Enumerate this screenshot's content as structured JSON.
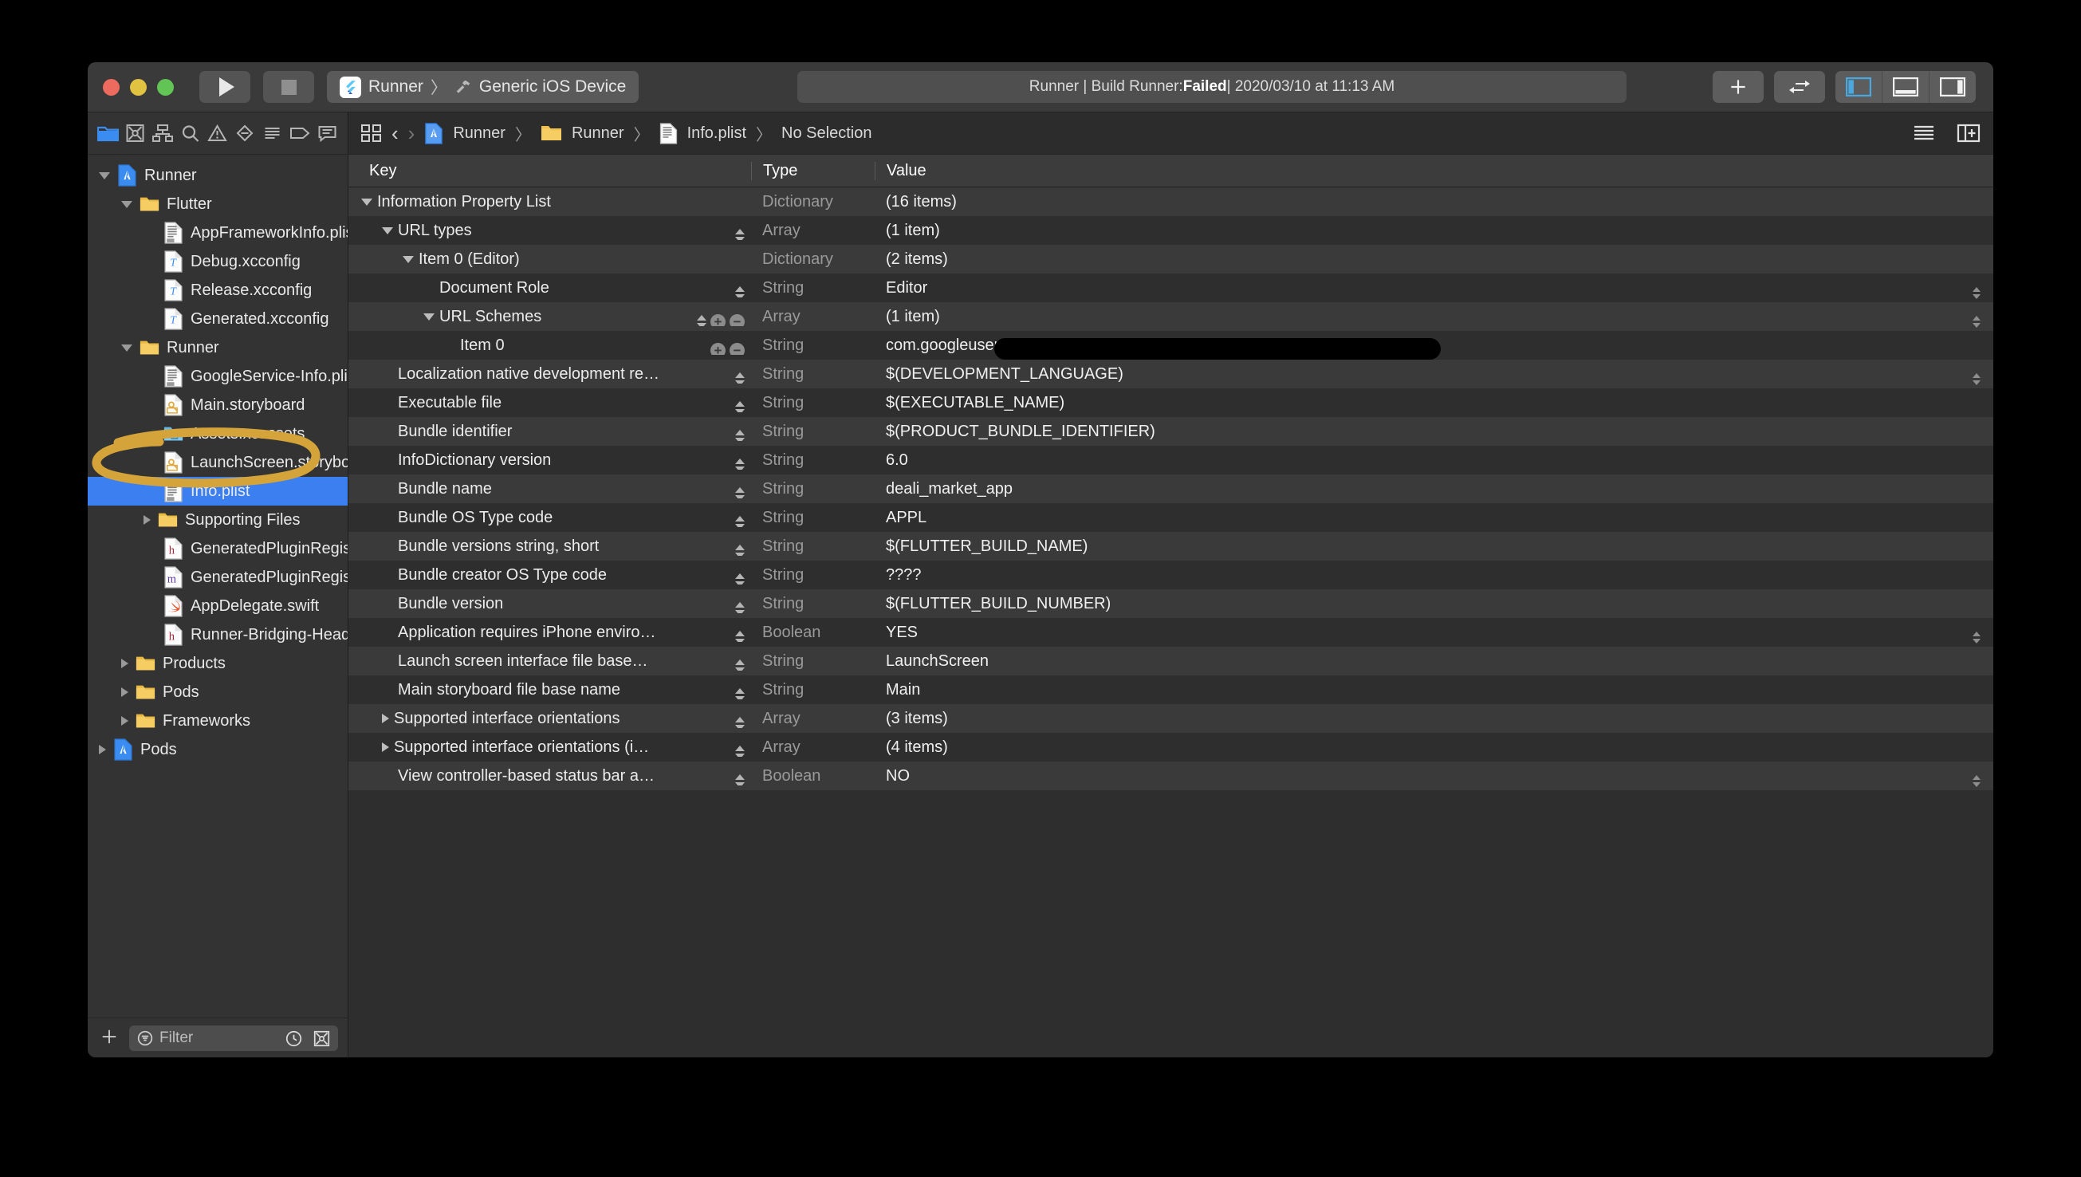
{
  "window": {
    "traffic_lights": [
      "close",
      "minimize",
      "zoom"
    ],
    "run_button": "run-button",
    "stop_button": "stop-button",
    "scheme": {
      "target": "Runner",
      "separator": "〉",
      "destination": "Generic iOS Device"
    },
    "status": {
      "prefix": "Runner | Build Runner: ",
      "result": "Failed",
      "suffix": " | 2020/03/10 at 11:13 AM"
    },
    "right_tools": {
      "add_label": "+",
      "toggle_label": "⇄"
    }
  },
  "navigator": {
    "toolbar_icons": [
      "folder-icon",
      "source-control-icon",
      "symbol-hierarchy-icon",
      "search-icon",
      "warning-icon",
      "breakpoint-icon",
      "report-icon",
      "tag-icon",
      "comment-icon"
    ],
    "tree": [
      {
        "label": "Runner",
        "indent": 0,
        "tri": "open",
        "icon": "xcode-project",
        "selected": false
      },
      {
        "label": "Flutter",
        "indent": 1,
        "tri": "open",
        "icon": "folder",
        "selected": false
      },
      {
        "label": "AppFrameworkInfo.plist",
        "indent": 2,
        "tri": "none",
        "icon": "plist",
        "selected": false
      },
      {
        "label": "Debug.xcconfig",
        "indent": 2,
        "tri": "none",
        "icon": "xcconfig",
        "selected": false
      },
      {
        "label": "Release.xcconfig",
        "indent": 2,
        "tri": "none",
        "icon": "xcconfig",
        "selected": false
      },
      {
        "label": "Generated.xcconfig",
        "indent": 2,
        "tri": "none",
        "icon": "xcconfig",
        "selected": false
      },
      {
        "label": "Runner",
        "indent": 1,
        "tri": "open",
        "icon": "folder",
        "selected": false
      },
      {
        "label": "GoogleService-Info.plist",
        "indent": 2,
        "tri": "none",
        "icon": "plist",
        "selected": false
      },
      {
        "label": "Main.storyboard",
        "indent": 2,
        "tri": "none",
        "icon": "storyboard",
        "selected": false
      },
      {
        "label": "Assets.xcassets",
        "indent": 2,
        "tri": "none",
        "icon": "xcassets",
        "selected": false
      },
      {
        "label": "LaunchScreen.storyboard",
        "indent": 2,
        "tri": "none",
        "icon": "storyboard",
        "selected": false
      },
      {
        "label": "Info.plist",
        "indent": 2,
        "tri": "none",
        "icon": "plist",
        "selected": true
      },
      {
        "label": "Supporting Files",
        "indent": 2,
        "tri": "closed",
        "icon": "folder",
        "selected": false
      },
      {
        "label": "GeneratedPluginRegistrant.h",
        "indent": 2,
        "tri": "none",
        "icon": "header",
        "selected": false
      },
      {
        "label": "GeneratedPluginRegistrant.m",
        "indent": 2,
        "tri": "none",
        "icon": "objc",
        "selected": false
      },
      {
        "label": "AppDelegate.swift",
        "indent": 2,
        "tri": "none",
        "icon": "swift",
        "selected": false
      },
      {
        "label": "Runner-Bridging-Header.h",
        "indent": 2,
        "tri": "none",
        "icon": "header",
        "selected": false
      },
      {
        "label": "Products",
        "indent": 1,
        "tri": "closed",
        "icon": "folder",
        "selected": false
      },
      {
        "label": "Pods",
        "indent": 1,
        "tri": "closed",
        "icon": "folder",
        "selected": false
      },
      {
        "label": "Frameworks",
        "indent": 1,
        "tri": "closed",
        "icon": "folder",
        "selected": false
      },
      {
        "label": "Pods",
        "indent": 0,
        "tri": "closed",
        "icon": "xcode-project",
        "selected": false
      }
    ],
    "filter": {
      "placeholder": "Filter",
      "add_label": "+",
      "recent_icon": "clock-icon",
      "scm_icon": "source-control-icon"
    }
  },
  "annotation": {
    "color": "#d4a339",
    "target_label": "GoogleService-Info.plist",
    "shape": "hand-drawn-ellipse"
  },
  "editor": {
    "jumpbar": {
      "grid_icon": "related-items-icon",
      "back_label": "‹",
      "forward_label": "›",
      "crumbs": [
        {
          "label": "Runner",
          "icon": "xcode-project"
        },
        {
          "label": "Runner",
          "icon": "folder"
        },
        {
          "label": "Info.plist",
          "icon": "plist"
        },
        {
          "label": "No Selection",
          "icon": "none"
        }
      ],
      "separator": "〉",
      "options_icon": "editor-options-icon",
      "add_editor_icon": "add-editor-icon"
    },
    "columns": [
      "Key",
      "Type",
      "Value"
    ],
    "rows": [
      {
        "key": "Information Property List",
        "indent": 0,
        "tri": "open",
        "type": "Dictionary",
        "value": "(16 items)",
        "stepper": false,
        "vstep": false,
        "plusminus": false
      },
      {
        "key": "URL types",
        "indent": 1,
        "tri": "open",
        "type": "Array",
        "value": "(1 item)",
        "stepper": true,
        "vstep": false,
        "plusminus": false
      },
      {
        "key": "Item 0 (Editor)",
        "indent": 2,
        "tri": "open",
        "type": "Dictionary",
        "value": "(2 items)",
        "stepper": false,
        "vstep": false,
        "plusminus": false
      },
      {
        "key": "Document Role",
        "indent": 3,
        "tri": "blank",
        "type": "String",
        "value": "Editor",
        "stepper": true,
        "vstep": true,
        "plusminus": false
      },
      {
        "key": "URL Schemes",
        "indent": 3,
        "tri": "open",
        "type": "Array",
        "value": "(1 item)",
        "stepper": true,
        "vstep": true,
        "plusminus": true
      },
      {
        "key": "Item 0",
        "indent": 4,
        "tri": "blank",
        "type": "String",
        "value": "com.googleusercontent",
        "stepper": false,
        "vstep": false,
        "plusminus": true,
        "redacted": true
      },
      {
        "key": "Localization native development re…",
        "indent": 1,
        "tri": "blank",
        "type": "String",
        "value": "$(DEVELOPMENT_LANGUAGE)",
        "stepper": true,
        "vstep": true,
        "plusminus": false
      },
      {
        "key": "Executable file",
        "indent": 1,
        "tri": "blank",
        "type": "String",
        "value": "$(EXECUTABLE_NAME)",
        "stepper": true,
        "vstep": false,
        "plusminus": false
      },
      {
        "key": "Bundle identifier",
        "indent": 1,
        "tri": "blank",
        "type": "String",
        "value": "$(PRODUCT_BUNDLE_IDENTIFIER)",
        "stepper": true,
        "vstep": false,
        "plusminus": false
      },
      {
        "key": "InfoDictionary version",
        "indent": 1,
        "tri": "blank",
        "type": "String",
        "value": "6.0",
        "stepper": true,
        "vstep": false,
        "plusminus": false
      },
      {
        "key": "Bundle name",
        "indent": 1,
        "tri": "blank",
        "type": "String",
        "value": "deali_market_app",
        "stepper": true,
        "vstep": false,
        "plusminus": false
      },
      {
        "key": "Bundle OS Type code",
        "indent": 1,
        "tri": "blank",
        "type": "String",
        "value": "APPL",
        "stepper": true,
        "vstep": false,
        "plusminus": false
      },
      {
        "key": "Bundle versions string, short",
        "indent": 1,
        "tri": "blank",
        "type": "String",
        "value": "$(FLUTTER_BUILD_NAME)",
        "stepper": true,
        "vstep": false,
        "plusminus": false
      },
      {
        "key": "Bundle creator OS Type code",
        "indent": 1,
        "tri": "blank",
        "type": "String",
        "value": "????",
        "stepper": true,
        "vstep": false,
        "plusminus": false
      },
      {
        "key": "Bundle version",
        "indent": 1,
        "tri": "blank",
        "type": "String",
        "value": "$(FLUTTER_BUILD_NUMBER)",
        "stepper": true,
        "vstep": false,
        "plusminus": false
      },
      {
        "key": "Application requires iPhone enviro…",
        "indent": 1,
        "tri": "blank",
        "type": "Boolean",
        "value": "YES",
        "stepper": true,
        "vstep": true,
        "plusminus": false
      },
      {
        "key": "Launch screen interface file base…",
        "indent": 1,
        "tri": "blank",
        "type": "String",
        "value": "LaunchScreen",
        "stepper": true,
        "vstep": false,
        "plusminus": false
      },
      {
        "key": "Main storyboard file base name",
        "indent": 1,
        "tri": "blank",
        "type": "String",
        "value": "Main",
        "stepper": true,
        "vstep": false,
        "plusminus": false
      },
      {
        "key": "Supported interface orientations",
        "indent": 1,
        "tri": "closed",
        "type": "Array",
        "value": "(3 items)",
        "stepper": true,
        "vstep": false,
        "plusminus": false
      },
      {
        "key": "Supported interface orientations (i…",
        "indent": 1,
        "tri": "closed",
        "type": "Array",
        "value": "(4 items)",
        "stepper": true,
        "vstep": false,
        "plusminus": false
      },
      {
        "key": "View controller-based status bar a…",
        "indent": 1,
        "tri": "blank",
        "type": "Boolean",
        "value": "NO",
        "stepper": true,
        "vstep": true,
        "plusminus": false
      }
    ]
  }
}
